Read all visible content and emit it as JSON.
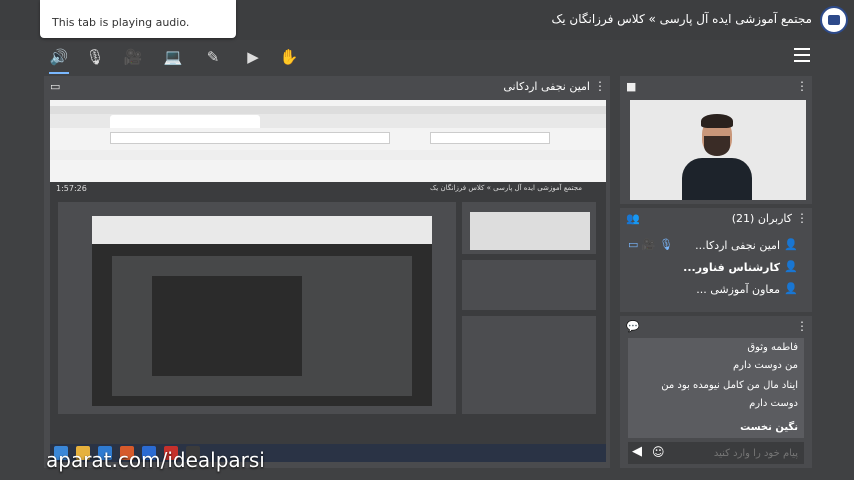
{
  "tooltip": {
    "text": "This tab is playing audio."
  },
  "header": {
    "breadcrumb": "مجتمع آموزشی ایده آل پارسی » کلاس فرزانگان یک"
  },
  "toolbar": {
    "items": [
      {
        "name": "speaker",
        "glyph": "🔊"
      },
      {
        "name": "mic-muted",
        "glyph": "🎙"
      },
      {
        "name": "camera",
        "glyph": "🎥"
      },
      {
        "name": "screen",
        "glyph": "💻"
      },
      {
        "name": "pen",
        "glyph": "✎"
      },
      {
        "name": "present",
        "glyph": "▶"
      },
      {
        "name": "hand",
        "glyph": "✋"
      }
    ]
  },
  "share": {
    "title": "امین نجفی اردکانی"
  },
  "inner": {
    "time": "1:57:26",
    "breadcrumb": "مجتمع آموزشی ایده آل پارسی » کلاس فرزانگان یک"
  },
  "users": {
    "title": "کاربران (21)",
    "list": [
      {
        "name": "امین نجفی اردکا...",
        "bold": false
      },
      {
        "name": "کارشناس فناور...",
        "bold": true
      },
      {
        "name": "معاون آموزشی ...",
        "bold": false
      }
    ]
  },
  "chat": {
    "messages": [
      "فاطمه وثوق",
      "من دوست دارم",
      "ایناد مال من کامل نیومده بود من",
      "دوست دارم",
      "نگین نخست"
    ],
    "placeholder": "پیام خود را وارد کنید"
  },
  "watermark": "aparat.com/idealparsi",
  "colors": {
    "accent": "#7ab8ff",
    "panel": "#4a4b4e",
    "background": "#404143"
  }
}
